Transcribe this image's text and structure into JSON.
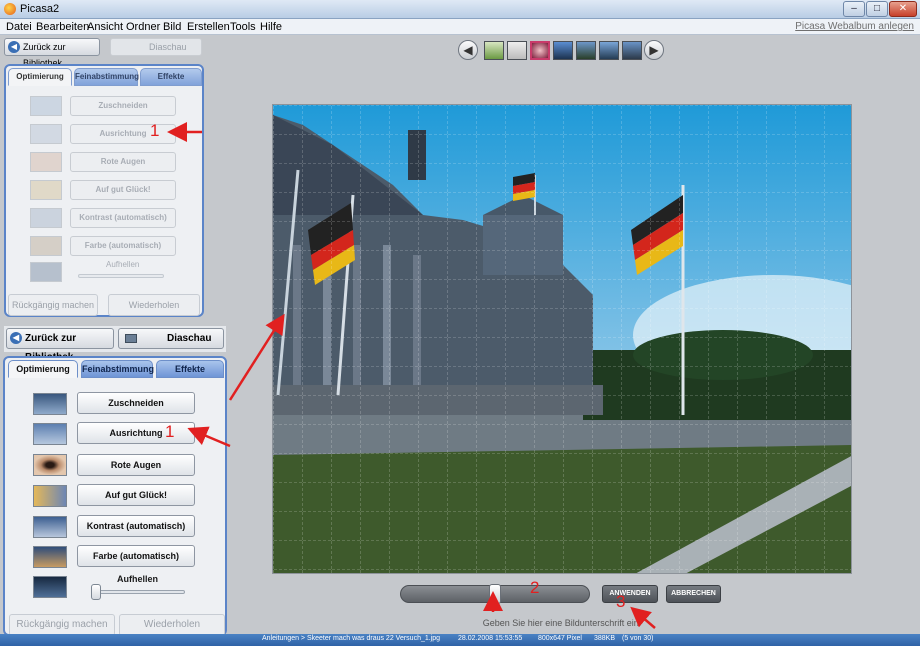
{
  "window": {
    "title": "Picasa2",
    "buttons": [
      "–",
      "□",
      "✕"
    ]
  },
  "menu": {
    "items": [
      "Datei",
      "Bearbeiten",
      "Ansicht",
      "Ordner",
      "Bild",
      "Erstellen",
      "Tools",
      "Hilfe"
    ],
    "web_album_link": "Picasa Webalbum anlegen"
  },
  "toolbar": {
    "back_label": "Zurück zur Bibliothek",
    "slideshow_label": "Diaschau"
  },
  "tabs": [
    "Optimierung",
    "Feinabstimmung",
    "Effekte"
  ],
  "tools": [
    {
      "label": "Zuschneiden",
      "thumb": "crop-thumb"
    },
    {
      "label": "Ausrichtung",
      "thumb": "straighten-thumb"
    },
    {
      "label": "Rote Augen",
      "thumb": "redeye-thumb"
    },
    {
      "label": "Auf gut Glück!",
      "thumb": "lucky-thumb"
    },
    {
      "label": "Kontrast (automatisch)",
      "thumb": "contrast-thumb"
    },
    {
      "label": "Farbe (automatisch)",
      "thumb": "color-thumb"
    }
  ],
  "fill_light": {
    "label": "Aufhellen",
    "level": 0
  },
  "footer_buttons": {
    "undo": "Rückgängig machen",
    "redo": "Wiederholen"
  },
  "annotations": {
    "one": "1",
    "two": "2",
    "three": "3"
  },
  "straighten": {
    "apply": "ANWENDEN",
    "cancel": "ABBRECHEN",
    "level": 0.5
  },
  "caption_placeholder": "Geben Sie hier eine Bildunterschrift ein!",
  "status": {
    "path": "Anleitungen > Skeeter mach was draus 22 Versuch_1.jpg",
    "date": "28.02.2008 15:53:55",
    "dimensions": "800x647 Pixel",
    "size": "388KB",
    "position": "(5 von 30)"
  },
  "colors": {
    "accent": "#5b84c8",
    "annotation": "#e12020",
    "status_bar": "#2f62a6"
  }
}
